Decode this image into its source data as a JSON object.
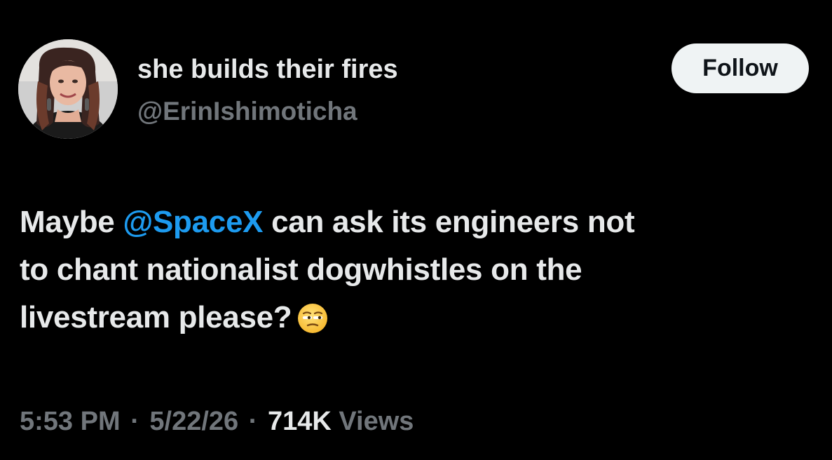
{
  "author": {
    "display_name": "she builds their fires",
    "handle": "@ErinIshimoticha",
    "avatar_icon": "profile-photo"
  },
  "follow_button": {
    "label": "Follow"
  },
  "tweet": {
    "line1_before": "Maybe ",
    "mention": "@SpaceX",
    "line1_after": " can ask its engineers not",
    "line2": "to chant nationalist dogwhistles on the",
    "line3": "livestream please?",
    "emoji_icon": "unamused-face-emoji"
  },
  "meta": {
    "time": "5:53 PM",
    "separator": "·",
    "date": "5/22/26",
    "views_count": "714K",
    "views_label": "Views"
  },
  "colors": {
    "background": "#000000",
    "primary_text": "#e7e9ea",
    "secondary_text": "#71767b",
    "link": "#1d9bf0",
    "follow_bg": "#eff3f4"
  }
}
